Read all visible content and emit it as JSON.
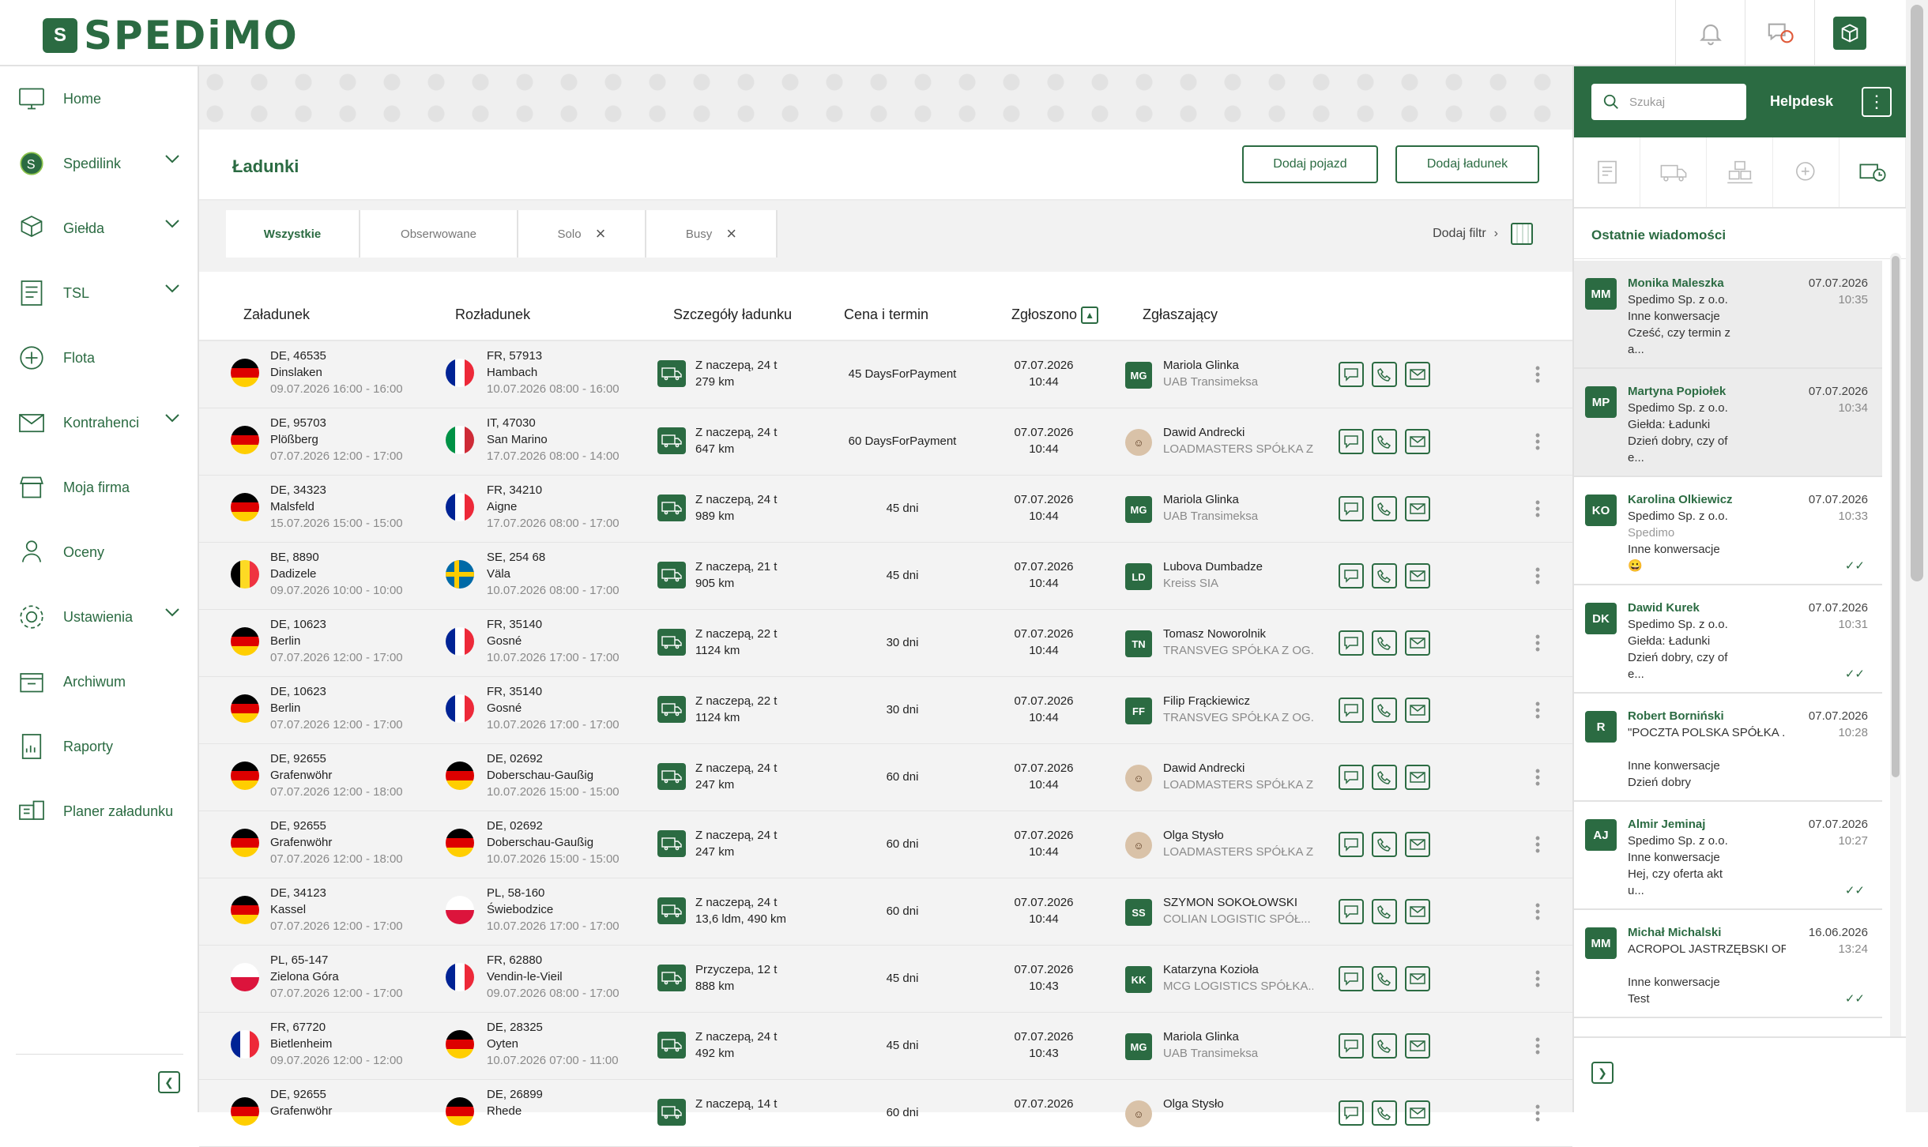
{
  "header": {
    "logo": "SPEDiMO",
    "logo_mark": "S"
  },
  "sidebar": {
    "items": [
      {
        "label": "Home",
        "icon": "monitor-icon",
        "chevron": false
      },
      {
        "label": "Spedilink",
        "icon": "spedilink-icon",
        "chevron": true
      },
      {
        "label": "Giełda",
        "icon": "boxes-icon",
        "chevron": true
      },
      {
        "label": "TSL",
        "icon": "document-list-icon",
        "chevron": true
      },
      {
        "label": "Flota",
        "icon": "fleet-icon",
        "chevron": false
      },
      {
        "label": "Kontrahenci",
        "icon": "envelope-icon",
        "chevron": true
      },
      {
        "label": "Moja firma",
        "icon": "store-icon",
        "chevron": false
      },
      {
        "label": "Oceny",
        "icon": "rating-icon",
        "chevron": false
      },
      {
        "label": "Ustawienia",
        "icon": "gear-icon",
        "chevron": true
      },
      {
        "label": "Archiwum",
        "icon": "archive-icon",
        "chevron": false
      },
      {
        "label": "Raporty",
        "icon": "report-icon",
        "chevron": false
      },
      {
        "label": "Planer załadunku",
        "icon": "loading-planner-icon",
        "chevron": false
      }
    ]
  },
  "page": {
    "title": "Ładunki",
    "add_vehicle": "Dodaj pojazd",
    "add_load": "Dodaj ładunek"
  },
  "filters": {
    "tabs": [
      "Wszystkie",
      "Obserwowane",
      "Solo",
      "Busy"
    ],
    "add_filter": "Dodaj filtr"
  },
  "table": {
    "headers": {
      "loading": "Załadunek",
      "unloading": "Rozładunek",
      "details": "Szczegóły ładunku",
      "price": "Cena i termin",
      "reported": "Zgłoszono",
      "reporter": "Zgłaszający"
    },
    "rows": [
      {
        "from_flag": "DE",
        "from_loc": "DE, 46535",
        "from_city": "Dinslaken",
        "from_date": "09.07.2026 16:00 - 16:00",
        "to_flag": "FR",
        "to_loc": "FR, 57913",
        "to_city": "Hambach",
        "to_date": "10.07.2026 08:00 - 16:00",
        "truck": "Z naczepą, 24 t",
        "dist": "279 km",
        "price": "45 DaysForPayment",
        "date": "07.07.2026",
        "time": "10:44",
        "av": "MG",
        "photo": false,
        "person": "Mariola Glinka",
        "company": "UAB Transimeksa"
      },
      {
        "from_flag": "DE",
        "from_loc": "DE, 95703",
        "from_city": "Plößberg",
        "from_date": "07.07.2026 12:00 - 17:00",
        "to_flag": "IT",
        "to_loc": "IT, 47030",
        "to_city": "San Marino",
        "to_date": "17.07.2026 08:00 - 14:00",
        "truck": "Z naczepą, 24 t",
        "dist": "647 km",
        "price": "60 DaysForPayment",
        "date": "07.07.2026",
        "time": "10:44",
        "av": "",
        "photo": true,
        "person": "Dawid Andrecki",
        "company": "LOADMASTERS SPÓŁKA Z..."
      },
      {
        "from_flag": "DE",
        "from_loc": "DE, 34323",
        "from_city": "Malsfeld",
        "from_date": "15.07.2026 15:00 - 15:00",
        "to_flag": "FR",
        "to_loc": "FR, 34210",
        "to_city": "Aigne",
        "to_date": "17.07.2026 08:00 - 17:00",
        "truck": "Z naczepą, 24 t",
        "dist": "989 km",
        "price": "45 dni",
        "date": "07.07.2026",
        "time": "10:44",
        "av": "MG",
        "photo": false,
        "person": "Mariola Glinka",
        "company": "UAB Transimeksa"
      },
      {
        "from_flag": "BE",
        "from_loc": "BE, 8890",
        "from_city": "Dadizele",
        "from_date": "09.07.2026 10:00 - 10:00",
        "to_flag": "SE",
        "to_loc": "SE, 254 68",
        "to_city": "Väla",
        "to_date": "10.07.2026 08:00 - 17:00",
        "truck": "Z naczepą, 21 t",
        "dist": "905 km",
        "price": "45 dni",
        "date": "07.07.2026",
        "time": "10:44",
        "av": "LD",
        "photo": false,
        "person": "Lubova Dumbadze",
        "company": "Kreiss SIA"
      },
      {
        "from_flag": "DE",
        "from_loc": "DE, 10623",
        "from_city": "Berlin",
        "from_date": "07.07.2026 12:00 - 17:00",
        "to_flag": "FR",
        "to_loc": "FR, 35140",
        "to_city": "Gosné",
        "to_date": "10.07.2026 17:00 - 17:00",
        "truck": "Z naczepą, 22 t",
        "dist": "1124 km",
        "price": "30 dni",
        "date": "07.07.2026",
        "time": "10:44",
        "av": "TN",
        "photo": false,
        "person": "Tomasz Noworolnik",
        "company": "TRANSVEG SPÓŁKA Z OG..."
      },
      {
        "from_flag": "DE",
        "from_loc": "DE, 10623",
        "from_city": "Berlin",
        "from_date": "07.07.2026 12:00 - 17:00",
        "to_flag": "FR",
        "to_loc": "FR, 35140",
        "to_city": "Gosné",
        "to_date": "10.07.2026 17:00 - 17:00",
        "truck": "Z naczepą, 22 t",
        "dist": "1124 km",
        "price": "30 dni",
        "date": "07.07.2026",
        "time": "10:44",
        "av": "FF",
        "photo": false,
        "person": "Filip Frąckiewicz",
        "company": "TRANSVEG SPÓŁKA Z OG..."
      },
      {
        "from_flag": "DE",
        "from_loc": "DE, 92655",
        "from_city": "Grafenwöhr",
        "from_date": "07.07.2026 12:00 - 18:00",
        "to_flag": "DE",
        "to_loc": "DE, 02692",
        "to_city": "Doberschau-Gaußig",
        "to_date": "10.07.2026 15:00 - 15:00",
        "truck": "Z naczepą, 24 t",
        "dist": "247 km",
        "price": "60 dni",
        "date": "07.07.2026",
        "time": "10:44",
        "av": "",
        "photo": true,
        "person": "Dawid Andrecki",
        "company": "LOADMASTERS SPÓŁKA Z..."
      },
      {
        "from_flag": "DE",
        "from_loc": "DE, 92655",
        "from_city": "Grafenwöhr",
        "from_date": "07.07.2026 12:00 - 18:00",
        "to_flag": "DE",
        "to_loc": "DE, 02692",
        "to_city": "Doberschau-Gaußig",
        "to_date": "10.07.2026 15:00 - 15:00",
        "truck": "Z naczepą, 24 t",
        "dist": "247 km",
        "price": "60 dni",
        "date": "07.07.2026",
        "time": "10:44",
        "av": "",
        "photo": true,
        "person": "Olga Stysło",
        "company": "LOADMASTERS SPÓŁKA Z..."
      },
      {
        "from_flag": "DE",
        "from_loc": "DE, 34123",
        "from_city": "Kassel",
        "from_date": "07.07.2026 12:00 - 17:00",
        "to_flag": "PL",
        "to_loc": "PL, 58-160",
        "to_city": "Świebodzice",
        "to_date": "10.07.2026 17:00 - 17:00",
        "truck": "Z naczepą, 24 t",
        "dist": "13,6 ldm, 490 km",
        "price": "60 dni",
        "date": "07.07.2026",
        "time": "10:44",
        "av": "SS",
        "photo": false,
        "person": "SZYMON SOKOŁOWSKI",
        "company": "COLIAN LOGISTIC SPÓŁ..."
      },
      {
        "from_flag": "PL",
        "from_loc": "PL, 65-147",
        "from_city": "Zielona Góra",
        "from_date": "07.07.2026 12:00 - 17:00",
        "to_flag": "FR",
        "to_loc": "FR, 62880",
        "to_city": "Vendin-le-Vieil",
        "to_date": "09.07.2026 08:00 - 17:00",
        "truck": "Przyczepa, 12 t",
        "dist": "888 km",
        "price": "45 dni",
        "date": "07.07.2026",
        "time": "10:43",
        "av": "KK",
        "photo": false,
        "person": "Katarzyna Kozioła",
        "company": "MCG LOGISTICS SPÓŁKA..."
      },
      {
        "from_flag": "FR",
        "from_loc": "FR, 67720",
        "from_city": "Bietlenheim",
        "from_date": "09.07.2026 12:00 - 12:00",
        "to_flag": "DE",
        "to_loc": "DE, 28325",
        "to_city": "Oyten",
        "to_date": "10.07.2026 07:00 - 11:00",
        "truck": "Z naczepą, 24 t",
        "dist": "492 km",
        "price": "45 dni",
        "date": "07.07.2026",
        "time": "10:43",
        "av": "MG",
        "photo": false,
        "person": "Mariola Glinka",
        "company": "UAB Transimeksa"
      },
      {
        "from_flag": "DE",
        "from_loc": "DE, 92655",
        "from_city": "Grafenwöhr",
        "from_date": "",
        "to_flag": "DE",
        "to_loc": "DE, 26899",
        "to_city": "Rhede",
        "to_date": "",
        "truck": "Z naczepą, 14 t",
        "dist": "",
        "price": "60 dni",
        "date": "07.07.2026",
        "time": "",
        "av": "",
        "photo": true,
        "person": "Olga Stysło",
        "company": ""
      }
    ]
  },
  "helpdesk": {
    "search_placeholder": "Szukaj",
    "title": "Helpdesk",
    "recent": "Ostatnie wiadomości",
    "messages": [
      {
        "av": "MM",
        "name": "Monika Maleszka",
        "lines": [
          "Spedimo Sp. z o.o.",
          "Inne konwersacje",
          "Cześć, czy termin z",
          "a..."
        ],
        "date": "07.07.2026",
        "time": "10:35",
        "unread": true,
        "check": false
      },
      {
        "av": "MP",
        "name": "Martyna Popiołek",
        "lines": [
          "Spedimo Sp. z o.o.",
          "Giełda: Ładunki",
          "Dzień dobry, czy of",
          "e..."
        ],
        "date": "07.07.2026",
        "time": "10:34",
        "unread": true,
        "check": false
      },
      {
        "av": "KO",
        "name": "Karolina Olkiewicz",
        "lines": [
          "Spedimo Sp. z o.o.",
          "Spedimo",
          "Inne konwersacje",
          "😀"
        ],
        "date": "07.07.2026",
        "time": "10:33",
        "unread": false,
        "check": true
      },
      {
        "av": "DK",
        "name": "Dawid Kurek",
        "lines": [
          "Spedimo Sp. z o.o.",
          "Giełda: Ładunki",
          "Dzień dobry, czy of",
          "e..."
        ],
        "date": "07.07.2026",
        "time": "10:31",
        "unread": false,
        "check": true
      },
      {
        "av": "R",
        "name": "Robert Borniński",
        "lines": [
          "\"POCZTA POLSKA SPÓŁKA ...",
          "",
          "Inne konwersacje",
          "Dzień dobry"
        ],
        "date": "07.07.2026",
        "time": "10:28",
        "unread": false,
        "check": false
      },
      {
        "av": "AJ",
        "name": "Almir Jeminaj",
        "lines": [
          "Spedimo Sp. z o.o.",
          "Inne konwersacje",
          "Hej, czy oferta akt",
          "u..."
        ],
        "date": "07.07.2026",
        "time": "10:27",
        "unread": false,
        "check": true
      },
      {
        "av": "MM",
        "name": "Michał Michalski",
        "lines": [
          "ACROPOL JASTRZĘBSKI OR...",
          "",
          "Inne konwersacje",
          "Test"
        ],
        "date": "16.06.2026",
        "time": "13:24",
        "unread": false,
        "check": true
      }
    ]
  },
  "colors": {
    "brand": "#2b6b42"
  }
}
